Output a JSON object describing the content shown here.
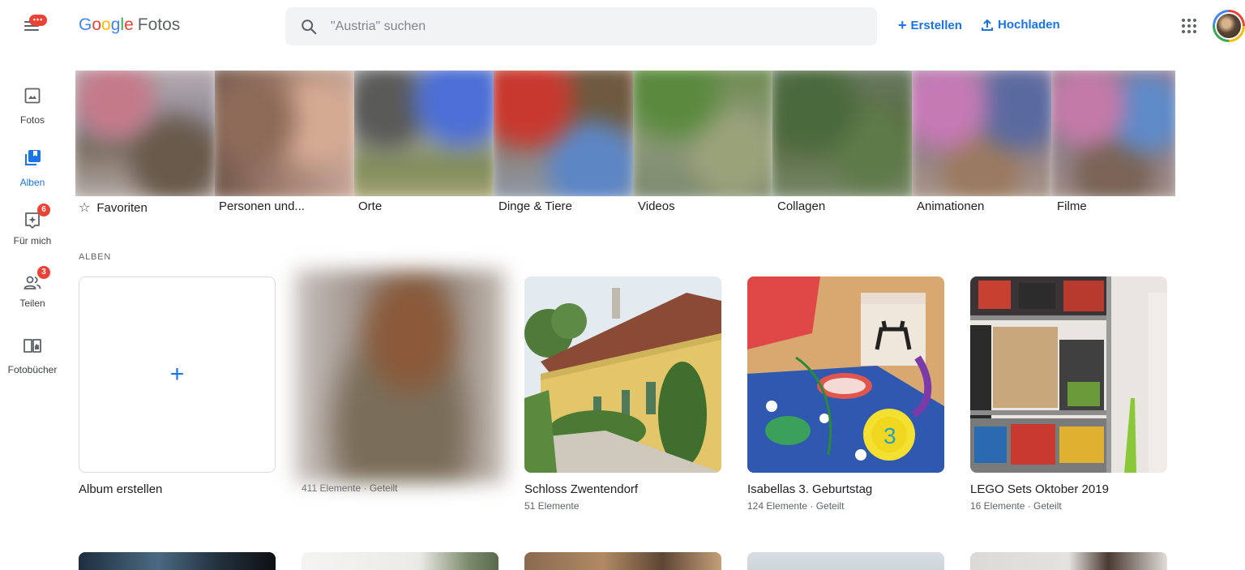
{
  "header": {
    "menu_badge": "•••",
    "logo_letters": [
      "G",
      "o",
      "o",
      "g",
      "l",
      "e"
    ],
    "logo_product": "Fotos",
    "search_placeholder": "\"Austria\" suchen",
    "create_label": "Erstellen",
    "upload_label": "Hochladen",
    "create_icon": "plus-icon",
    "upload_icon": "upload-icon"
  },
  "sidebar": {
    "items": [
      {
        "label": "Fotos",
        "icon": "photo-icon",
        "active": false
      },
      {
        "label": "Alben",
        "icon": "album-icon",
        "active": true
      },
      {
        "label": "Für mich",
        "icon": "assistant-icon",
        "badge": "6"
      },
      {
        "label": "Teilen",
        "icon": "people-icon",
        "badge": "3"
      },
      {
        "label": "Fotobücher",
        "icon": "photobook-icon"
      }
    ]
  },
  "categories": [
    {
      "label": "Favoriten",
      "icon": "star-outline-icon"
    },
    {
      "label": "Personen und..."
    },
    {
      "label": "Orte"
    },
    {
      "label": "Dinge & Tiere"
    },
    {
      "label": "Videos"
    },
    {
      "label": "Collagen"
    },
    {
      "label": "Animationen"
    },
    {
      "label": "Filme"
    }
  ],
  "albums_section": {
    "title": "ALBEN",
    "create_label": "Album erstellen",
    "create_icon": "plus-icon",
    "albums": [
      {
        "title": "",
        "meta": "411 Elemente · Geteilt"
      },
      {
        "title": "Schloss Zwentendorf",
        "meta": "51 Elemente"
      },
      {
        "title": "Isabellas 3. Geburtstag",
        "meta": "124 Elemente · Geteilt"
      },
      {
        "title": "LEGO Sets Oktober 2019",
        "meta": "16 Elemente · Geteilt"
      }
    ]
  },
  "colors": {
    "accent": "#1a73e8",
    "badge": "#ea4335",
    "search_bg": "#f1f3f4"
  }
}
